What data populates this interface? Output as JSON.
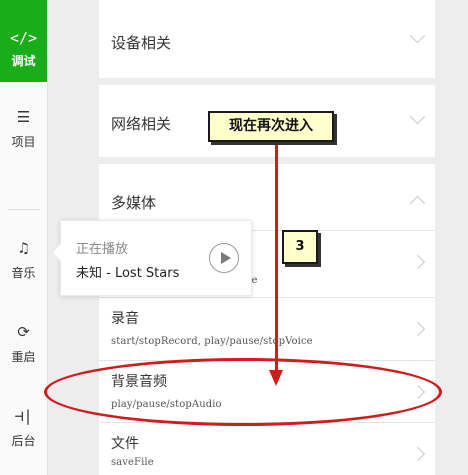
{
  "sidebar": {
    "items": [
      {
        "icon": "</>",
        "label": "调试",
        "active": true
      },
      {
        "icon": "☰",
        "label": "项目"
      },
      {
        "icon": "♫",
        "label": "音乐"
      },
      {
        "icon": "⟳",
        "label": "重启"
      },
      {
        "icon": "⊣|",
        "label": "后台"
      }
    ]
  },
  "main": {
    "sections": [
      {
        "title": "设备相关",
        "expanded": false
      },
      {
        "title": "网络相关",
        "expanded": false
      },
      {
        "title": "多媒体",
        "expanded": true
      }
    ],
    "media_items": [
      {
        "title": "",
        "subtitle": "ge"
      },
      {
        "title": "录音",
        "subtitle": "start/stopRecord, play/pause/stopVoice"
      },
      {
        "title": "背景音频",
        "subtitle": "play/pause/stopAudio"
      },
      {
        "title": "文件",
        "subtitle": "saveFile"
      }
    ]
  },
  "music_popup": {
    "title": "正在播放",
    "song": "未知 - Lost Stars"
  },
  "annotations": {
    "main_callout": "现在再次进入",
    "step_number": "3"
  },
  "colors": {
    "accent": "#1aad19",
    "annotation_red": "#d21b1b",
    "callout_bg": "#ffffcc"
  }
}
